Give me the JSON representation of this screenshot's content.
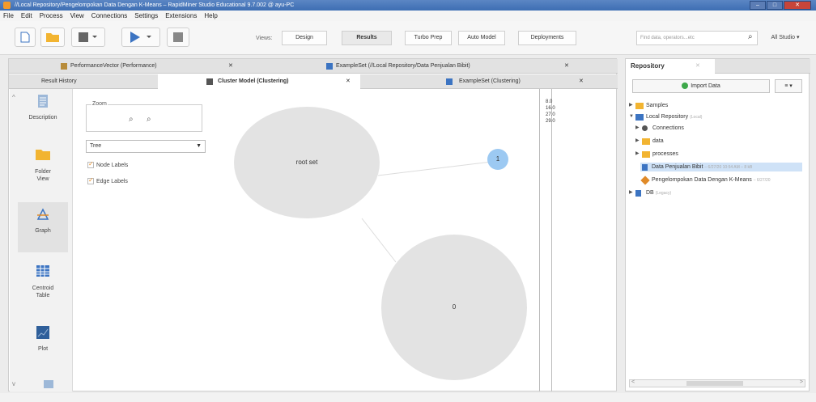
{
  "window": {
    "title": "//Local Repository/Pengelompokan Data Dengan K-Means – RapidMiner Studio Educational 9.7.002 @ ayu-PC",
    "controls": [
      "–",
      "□",
      "✕"
    ]
  },
  "menu": [
    "File",
    "Edit",
    "Process",
    "View",
    "Connections",
    "Settings",
    "Extensions",
    "Help"
  ],
  "toolbar": {
    "views_label": "Views:",
    "view_tabs": [
      "Design",
      "Results",
      "Turbo Prep",
      "Auto Model",
      "Deployments"
    ],
    "active_view": "Results",
    "search_placeholder": "Find data, operators...etc",
    "studio_label": "All Studio ▾"
  },
  "editor": {
    "tabs_row1": [
      {
        "label": "PerformanceVector (Performance)",
        "icon": "performance-icon"
      },
      {
        "label": "ExampleSet (//Local Repository/Data Penjualan Bibit)",
        "icon": "table-icon"
      }
    ],
    "tabs_row2": [
      {
        "label": "Result History"
      },
      {
        "label": "Cluster Model (Clustering)",
        "icon": "model-icon"
      },
      {
        "label": "ExampleSet (Clustering)",
        "icon": "table-icon"
      }
    ],
    "tab_close": "✕",
    "sidenav": [
      {
        "label": "Description",
        "icon": "description-icon"
      },
      {
        "label": "Folder View",
        "icon": "folder-icon"
      },
      {
        "label": "Graph",
        "icon": "graph-icon"
      },
      {
        "label": "Centroid Table",
        "icon": "centroid-table-icon"
      },
      {
        "label": "Plot",
        "icon": "plot-icon"
      }
    ],
    "active_nav": "Graph",
    "options": {
      "zoom_label": "Zoom",
      "layout_value": "Tree",
      "node_labels": "Node Labels",
      "edge_labels": "Edge Labels"
    },
    "graph": {
      "root_label": "root set",
      "node_1": "1",
      "node_0": "0"
    },
    "values": [
      "8.0",
      "16.0",
      "27.0",
      "29.0"
    ]
  },
  "repository": {
    "title": "Repository",
    "tab_close": "✕",
    "import_label": "Import Data",
    "menu_label": "≡ ▾",
    "tree": {
      "samples": "Samples",
      "local": "Local Repository",
      "local_sub": "(Local)",
      "connections": "Connections",
      "data": "data",
      "processes": "processes",
      "data_penjualan": "Data Penjualan Bibit",
      "data_penjualan_sub": "– 6/27/20 10:54 AM – 8 kB",
      "pengelompokan": "Pengelompokan Data Dengan K-Means",
      "pengelompokan_sub": "– 6/27/20",
      "db": "DB",
      "db_sub": "(Legacy)"
    }
  },
  "colors": {
    "accent_blue": "#3c74c2",
    "folder_yellow": "#f2b431",
    "node_grey": "#e3e3e3",
    "node_blue": "#9cc9f2",
    "check_orange": "#e9922b"
  }
}
